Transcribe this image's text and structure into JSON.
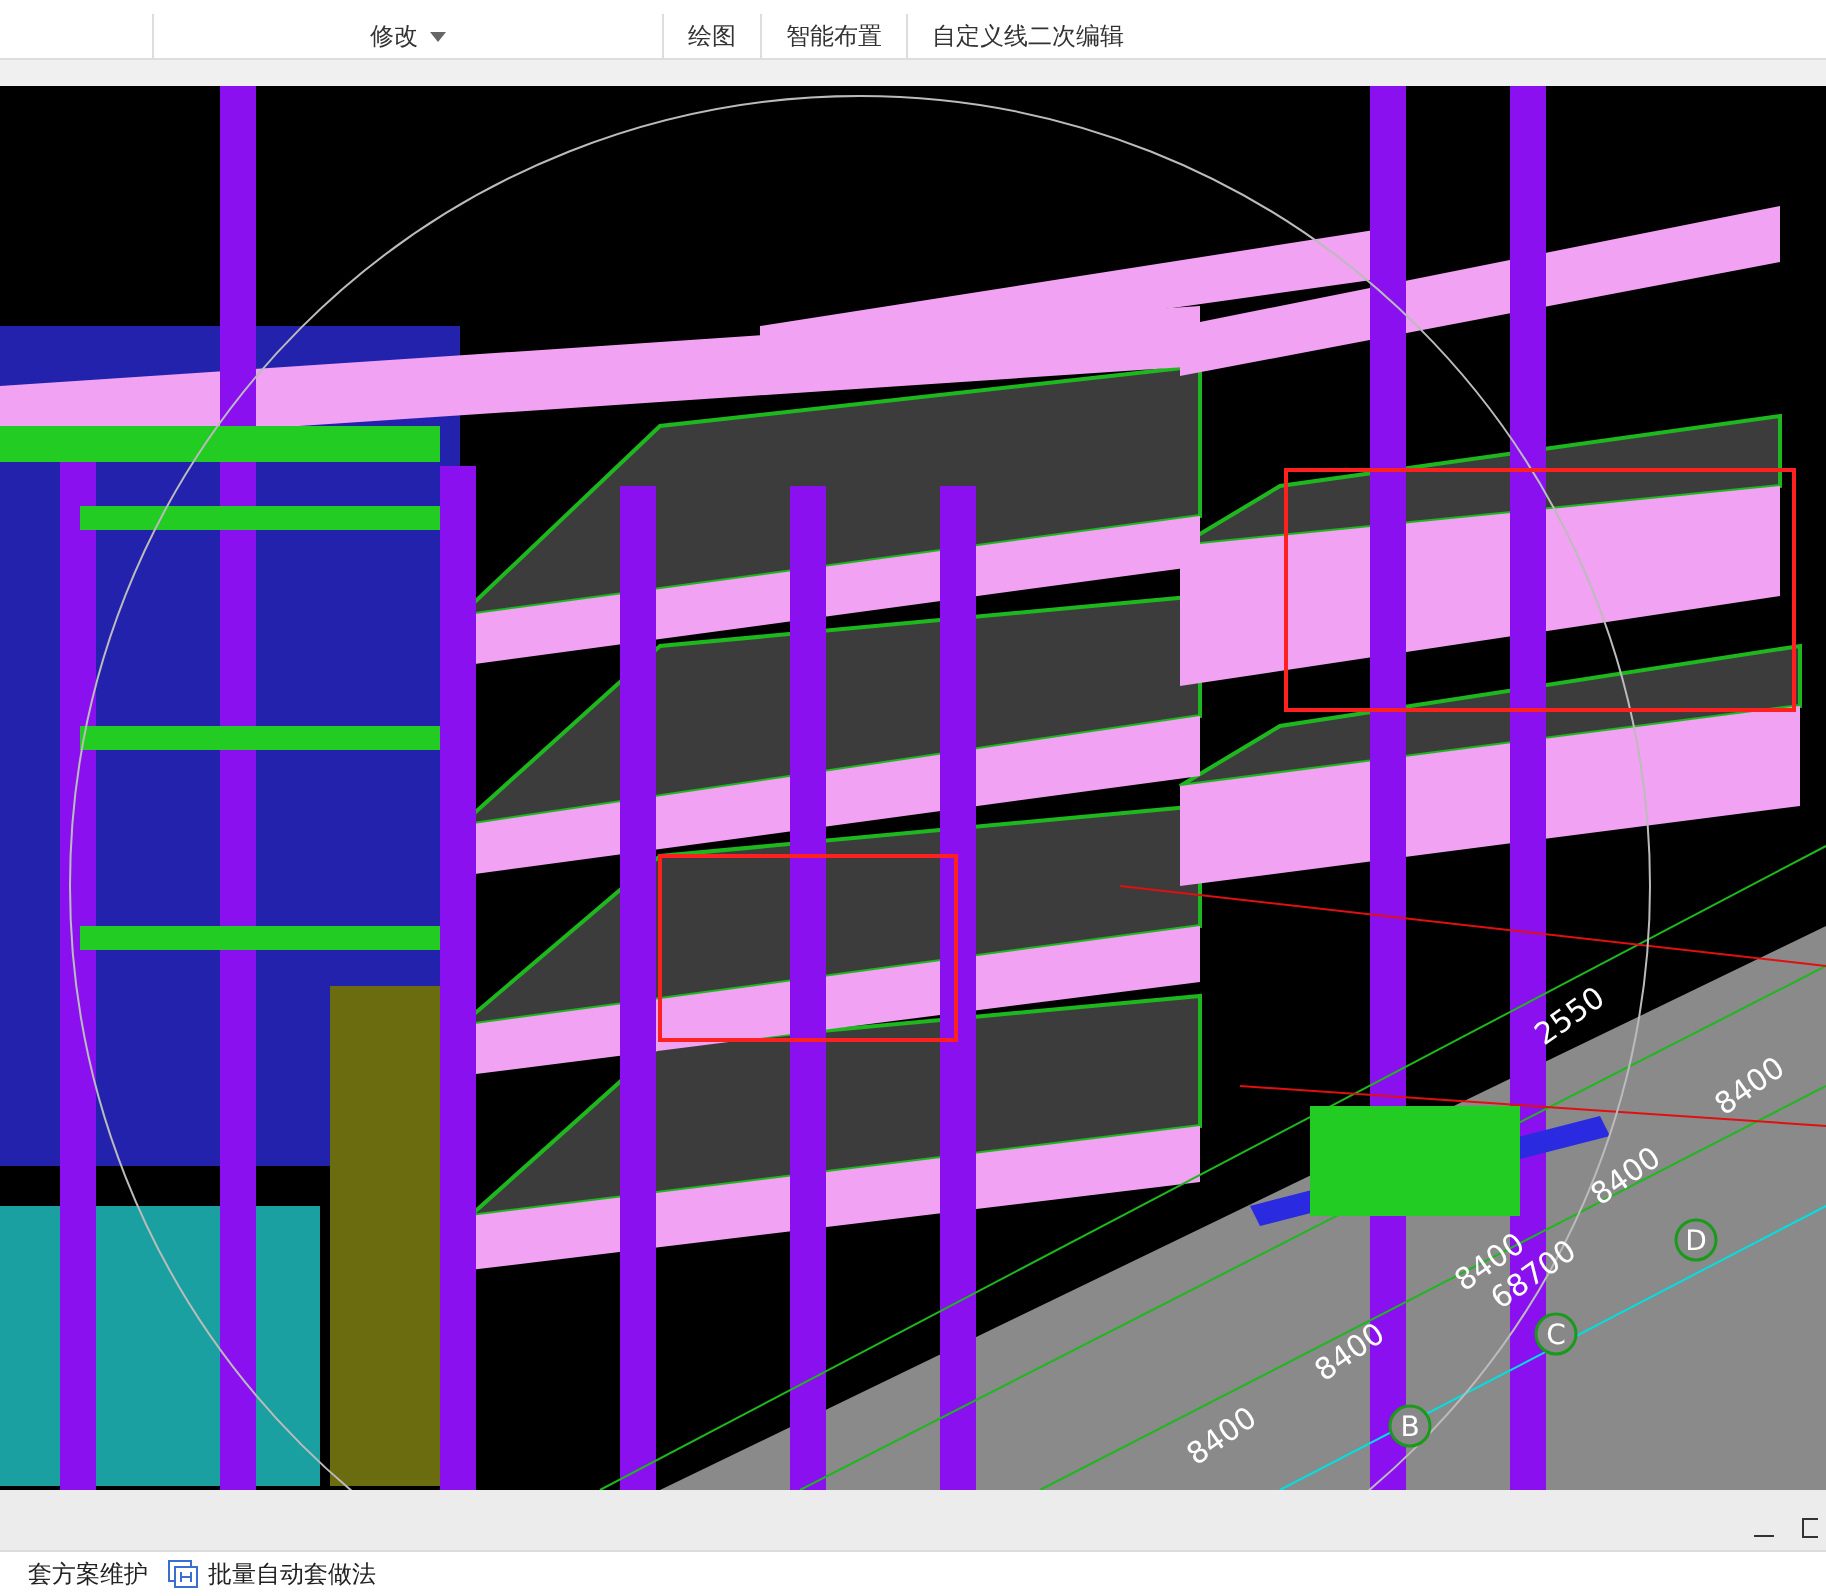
{
  "ribbon_groups": [
    {
      "label": "修改",
      "has_menu": true
    },
    {
      "label": "绘图",
      "has_menu": false
    },
    {
      "label": "智能布置",
      "has_menu": false
    },
    {
      "label": "自定义线二次编辑",
      "has_menu": false
    }
  ],
  "viewport": {
    "dimension_labels": [
      "8400",
      "8400",
      "8400",
      "8400",
      "8400",
      "68700",
      "2550"
    ],
    "axis_labels": [
      "B",
      "C",
      "D"
    ]
  },
  "bottom_tools": [
    {
      "label": "套方案维护",
      "kind": "text"
    },
    {
      "label": "批量自动套做法",
      "kind": "icon"
    }
  ]
}
